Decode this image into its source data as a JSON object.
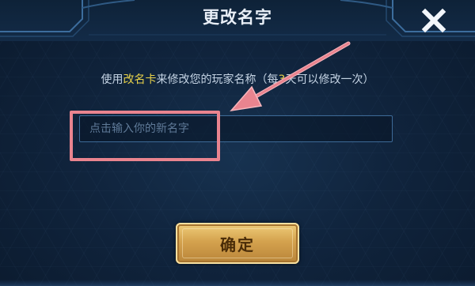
{
  "dialog": {
    "title": "更改名字",
    "message": {
      "before_item": "使用",
      "item": "改名卡",
      "after_item": "来修改您的玩家名称（每",
      "days": "3",
      "after_days": "天可以修改一次）"
    },
    "name_input": {
      "value": "",
      "placeholder": "点击输入你的新名字"
    },
    "confirm_label": "确定",
    "close_icon": "close-icon"
  },
  "colors": {
    "background": "#10243d",
    "highlight_text": "#e8d24a",
    "annotation": "#e9848f",
    "button_gold": "#d4a24e"
  }
}
